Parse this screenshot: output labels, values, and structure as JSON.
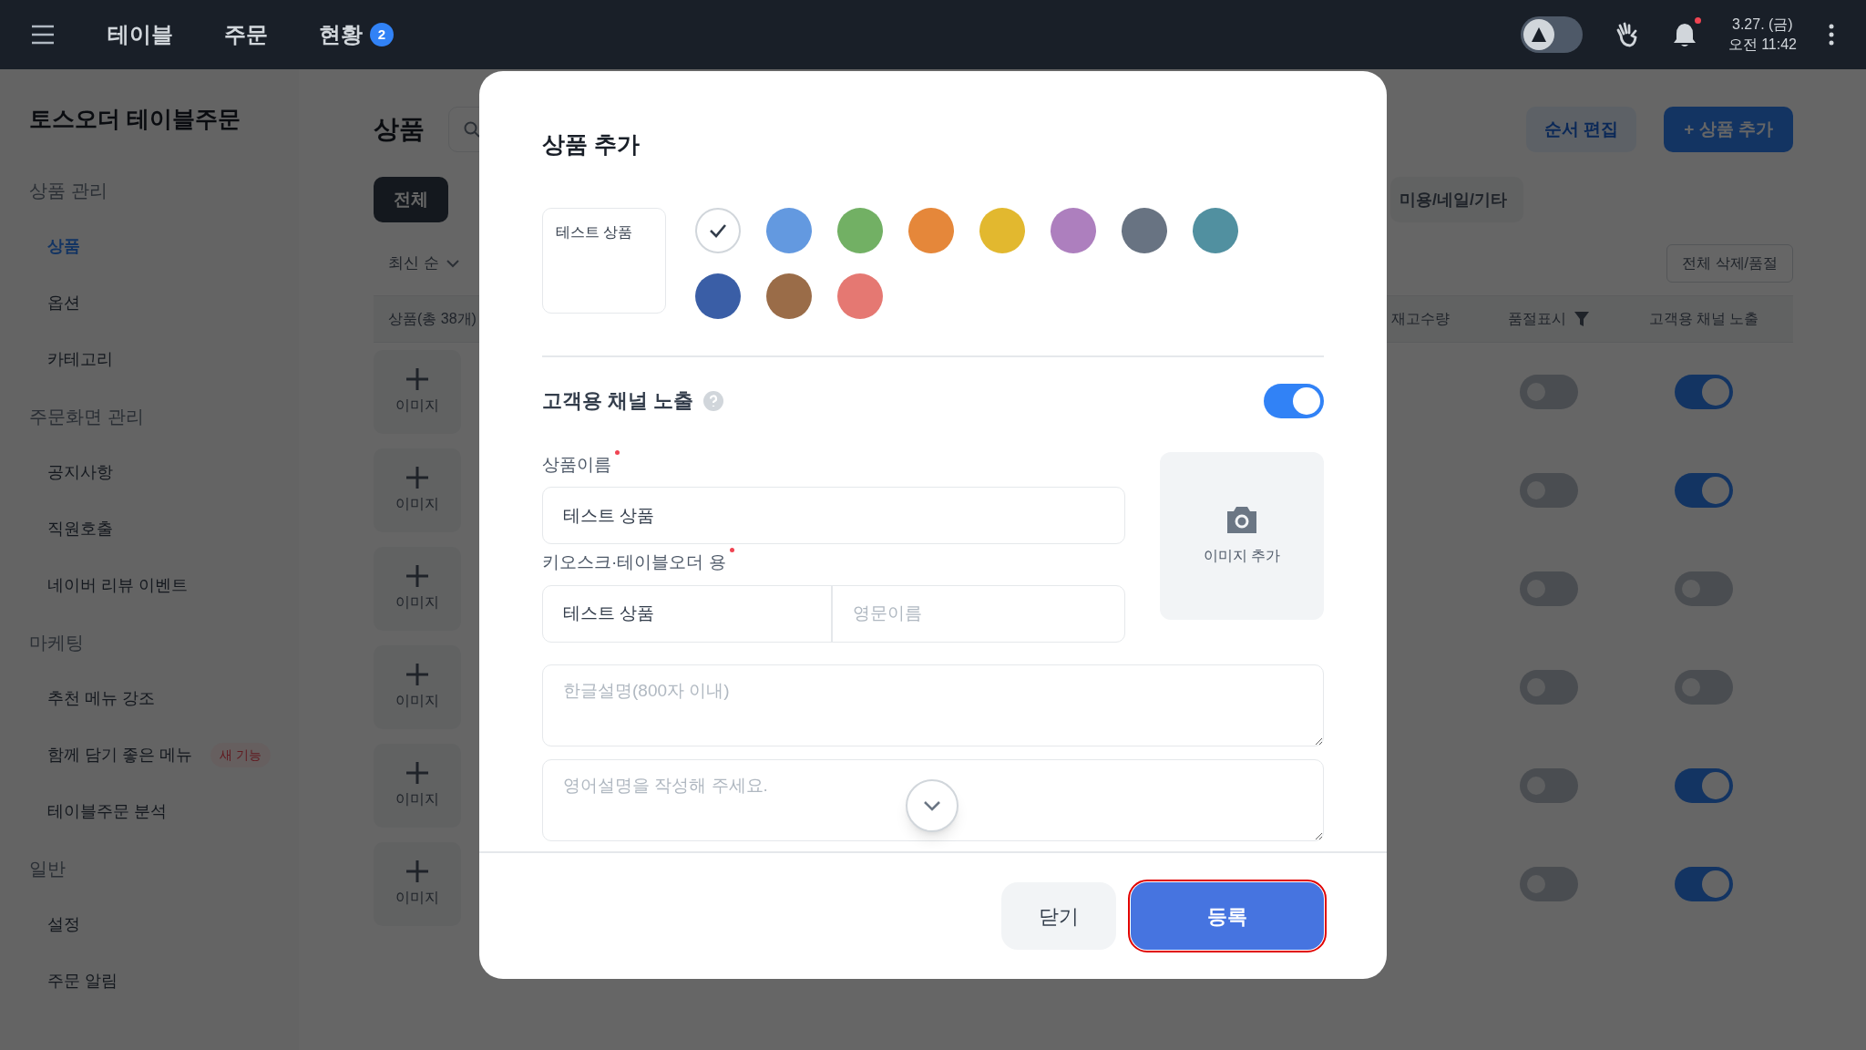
{
  "topbar": {
    "tabs": [
      {
        "label": "테이블"
      },
      {
        "label": "주문"
      },
      {
        "label": "현황",
        "badge": "2"
      }
    ],
    "theme_toggle": {
      "on": false
    },
    "notification_dot": true,
    "date": "3.27. (금)",
    "time": "오전 11:42"
  },
  "sidebar": {
    "title": "토스오더 테이블주문",
    "groups": [
      {
        "label": "상품 관리",
        "items": [
          {
            "label": "상품",
            "selected": true
          },
          {
            "label": "옵션",
            "selected": false
          },
          {
            "label": "카테고리",
            "selected": false
          }
        ]
      },
      {
        "label": "주문화면 관리",
        "items": [
          {
            "label": "공지사항",
            "selected": false
          },
          {
            "label": "직원호출",
            "selected": false
          },
          {
            "label": "네이버 리뷰 이벤트",
            "selected": false
          }
        ]
      },
      {
        "label": "마케팅",
        "items": [
          {
            "label": "추천 메뉴 강조",
            "selected": false
          },
          {
            "label": "함께 담기 좋은 메뉴",
            "selected": false,
            "badge": "새 기능"
          },
          {
            "label": "테이블주문 분석",
            "selected": false
          }
        ]
      },
      {
        "label": "일반",
        "items": [
          {
            "label": "설정",
            "selected": false
          },
          {
            "label": "주문 알림",
            "selected": false
          }
        ]
      }
    ]
  },
  "page": {
    "title": "상품",
    "buttons": [
      "순서 편집",
      "+ 상품 추가"
    ],
    "chips": [
      {
        "label": "전체",
        "selected": true
      },
      {
        "label": "미용/네일/기타",
        "selected": false
      }
    ],
    "sort": "최신 순",
    "bulk_button": "전체 삭제/품절",
    "columns": [
      "상품(총 38개)",
      "재고수량",
      "품절표시",
      "고객용 채널 노출"
    ],
    "rows": [
      {
        "image_label": "이미지",
        "sold_out": false,
        "channel": true
      },
      {
        "image_label": "이미지",
        "sold_out": false,
        "channel": true
      },
      {
        "image_label": "이미지",
        "sold_out": false,
        "channel": false
      },
      {
        "image_label": "이미지",
        "sold_out": false,
        "channel": false
      },
      {
        "image_label": "이미지",
        "sold_out": false,
        "channel": true
      },
      {
        "image_label": "이미지",
        "sold_out": false,
        "channel": true
      }
    ]
  },
  "modal": {
    "title": "상품 추가",
    "preview": "테스트 상품",
    "colors": [
      {
        "color": "#ffffff",
        "selected": true
      },
      {
        "color": "#6399e0",
        "selected": false
      },
      {
        "color": "#72b064",
        "selected": false
      },
      {
        "color": "#e5873a",
        "selected": false
      },
      {
        "color": "#e2b82f",
        "selected": false
      },
      {
        "color": "#ad7fbe",
        "selected": false
      },
      {
        "color": "#687382",
        "selected": false
      },
      {
        "color": "#5190a0",
        "selected": false
      },
      {
        "color": "#3a5ea6",
        "selected": false
      },
      {
        "color": "#9a6c48",
        "selected": false
      },
      {
        "color": "#e57872",
        "selected": false
      }
    ],
    "channel": {
      "label": "고객용 채널 노출",
      "on": true
    },
    "name": {
      "label": "상품이름",
      "required": true,
      "value": "테스트 상품"
    },
    "kiosk": {
      "label": "키오스크·테이블오더 용",
      "required": true,
      "value": "테스트 상품",
      "english_placeholder": "영문이름"
    },
    "image_button": "이미지 추가",
    "korean_desc": {
      "placeholder": "한글설명(800자 이내)"
    },
    "english_desc": {
      "placeholder": "영어설명을 작성해 주세요."
    },
    "close_button": "닫기",
    "submit_button": {
      "label": "등록",
      "highlighted": true
    }
  }
}
